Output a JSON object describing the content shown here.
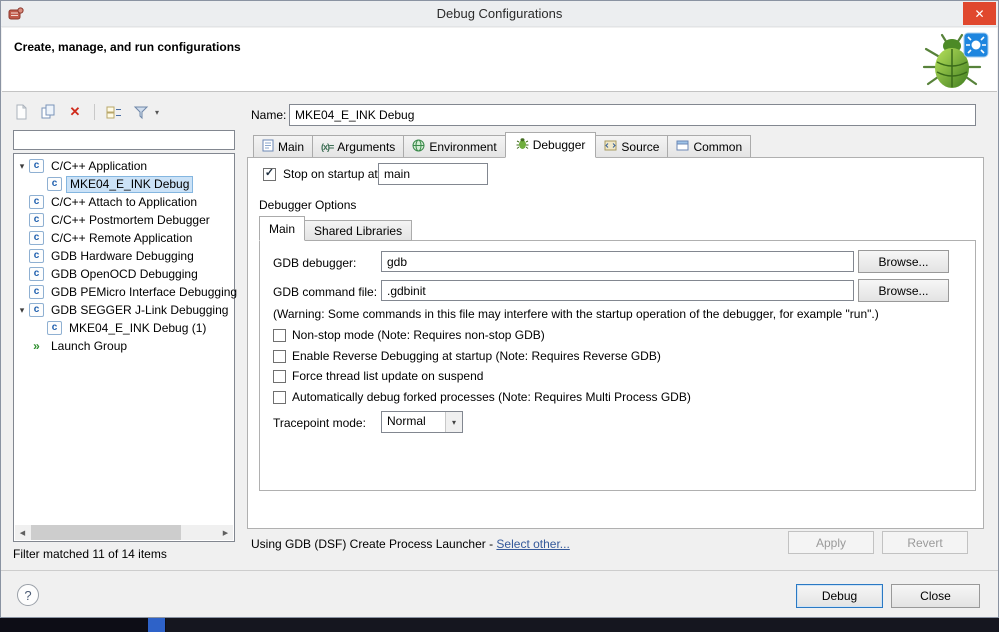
{
  "window": {
    "title": "Debug Configurations"
  },
  "icons": {
    "close": "✕",
    "delete": "✕",
    "expanded": "▾",
    "check": "✓",
    "dropdown": "▾",
    "scroll_left": "◀",
    "scroll_right": "▶",
    "help": "?",
    "arguments_glyph": "(x)=",
    "c_badge": "c",
    "launch_arrows": "»",
    "filter_dropdown": "▾"
  },
  "header": {
    "title": "Create, manage, and run configurations"
  },
  "sidebar": {
    "filter_value": "",
    "tree": [
      {
        "label": "C/C++ Application"
      },
      {
        "label": "MKE04_E_INK Debug"
      },
      {
        "label": "C/C++ Attach to Application"
      },
      {
        "label": "C/C++ Postmortem Debugger"
      },
      {
        "label": "C/C++ Remote Application"
      },
      {
        "label": "GDB Hardware Debugging"
      },
      {
        "label": "GDB OpenOCD Debugging"
      },
      {
        "label": "GDB PEMicro Interface Debugging"
      },
      {
        "label": "GDB SEGGER J-Link Debugging"
      },
      {
        "label": "MKE04_E_INK Debug (1)"
      },
      {
        "label": "Launch Group"
      }
    ],
    "status": "Filter matched 11 of 14 items"
  },
  "content": {
    "name_label": "Name:",
    "name_value": "MKE04_E_INK Debug",
    "tabs": {
      "main": "Main",
      "arguments": "Arguments",
      "environment": "Environment",
      "debugger": "Debugger",
      "source": "Source",
      "common": "Common"
    },
    "stop_label": "Stop on startup at:",
    "stop_value": "main",
    "options_title": "Debugger Options",
    "subtabs": {
      "main": "Main",
      "shared": "Shared Libraries"
    },
    "gdb_debugger_label": "GDB debugger:",
    "gdb_debugger_value": "gdb",
    "gdb_command_label": "GDB command file:",
    "gdb_command_value": ".gdbinit",
    "browse_label": "Browse...",
    "warning": "(Warning: Some commands in this file may interfere with the startup operation of the debugger, for example \"run\".)",
    "checkboxes": {
      "nonstop": "Non-stop mode (Note: Requires non-stop GDB)",
      "reverse": "Enable Reverse Debugging at startup (Note: Requires Reverse GDB)",
      "force_thread": "Force thread list update on suspend",
      "fork": "Automatically debug forked processes (Note: Requires Multi Process GDB)"
    },
    "tracepoint_label": "Tracepoint mode:",
    "tracepoint_value": "Normal",
    "launcher_text": "Using GDB (DSF) Create Process Launcher - ",
    "launcher_link": "Select other...",
    "apply_label": "Apply",
    "revert_label": "Revert"
  },
  "footer": {
    "debug_label": "Debug",
    "close_label": "Close"
  }
}
